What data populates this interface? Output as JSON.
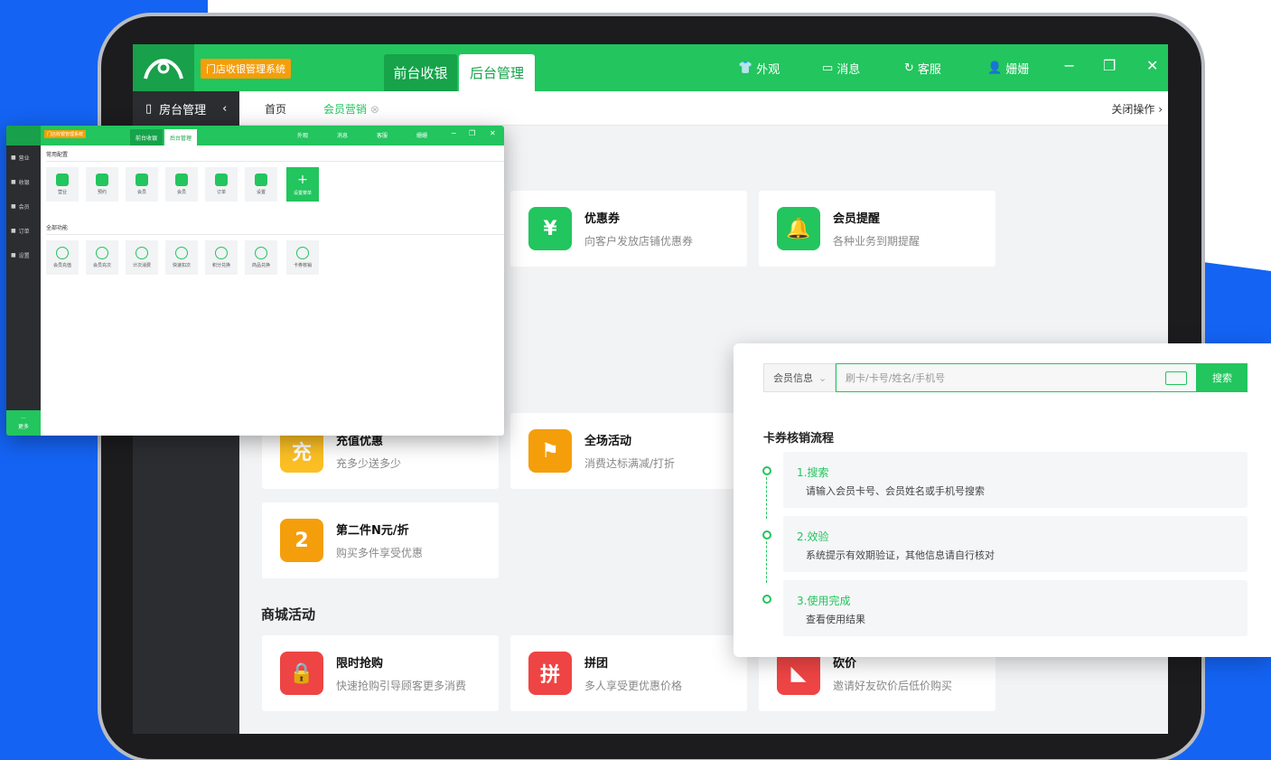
{
  "app": {
    "system_badge": "门店收银管理系统",
    "tabs": {
      "front": "前台收银",
      "back": "后台管理"
    },
    "nav": {
      "appearance": "外观",
      "messages": "消息",
      "service": "客服",
      "user": "姗姗"
    },
    "window": {
      "minimize": "−",
      "restore": "❐",
      "close": "✕"
    }
  },
  "subbar": {
    "side_title": "房台管理",
    "collapse": "‹",
    "crumb_home": "首页",
    "crumb_current": "会员营销",
    "close_ops": "关闭操作"
  },
  "cards": {
    "coupon": {
      "title": "优惠券",
      "desc": "向客户发放店铺优惠券",
      "icon": "¥"
    },
    "member_remind": {
      "title": "会员提醒",
      "desc": "各种业务到期提醒",
      "icon": "🔔"
    },
    "recharge": {
      "title": "充值优惠",
      "desc": "充多少送多少",
      "icon": "充"
    },
    "full_activity": {
      "title": "全场活动",
      "desc": "消费达标满减/打折",
      "icon": "⚑"
    },
    "second_item": {
      "title": "第二件N元/折",
      "desc": "购买多件享受优惠",
      "icon": "2"
    },
    "flash_sale": {
      "title": "限时抢购",
      "desc": "快速抢购引导顾客更多消费",
      "icon": "🔒"
    },
    "group_buy": {
      "title": "拼团",
      "desc": "多人享受更优惠价格",
      "icon": "拼"
    },
    "bargain": {
      "title": "砍价",
      "desc": "邀请好友砍价后低价购买",
      "icon": "◣"
    }
  },
  "section_mall": "商城活动",
  "mini": {
    "badge": "门店收银管理系统",
    "tab_front": "前台收银",
    "tab_back": "后台管理",
    "nav": [
      "外观",
      "消息",
      "客服",
      "姗姗"
    ],
    "side": [
      "营业",
      "收银",
      "会员",
      "订单",
      "设置"
    ],
    "more": "更多",
    "common_label": "常用配置",
    "all_label": "全部功能",
    "common_tiles": [
      "营业",
      "预约",
      "会员",
      "会员",
      "订单",
      "设置",
      "设置菜单"
    ],
    "all_tiles": [
      "会员充值",
      "会员充次",
      "计次消费",
      "快速扣次",
      "积分兑换",
      "商品兑换",
      "卡券核销"
    ]
  },
  "panel": {
    "select": "会员信息",
    "placeholder": "刷卡/卡号/姓名/手机号",
    "search": "搜索",
    "title": "卡券核销流程",
    "steps": [
      {
        "title": "1.搜索",
        "desc": "请输入会员卡号、会员姓名或手机号搜索"
      },
      {
        "title": "2.效验",
        "desc": "系统提示有效期验证，其他信息请自行核对"
      },
      {
        "title": "3.使用完成",
        "desc": "查看使用结果"
      }
    ]
  }
}
